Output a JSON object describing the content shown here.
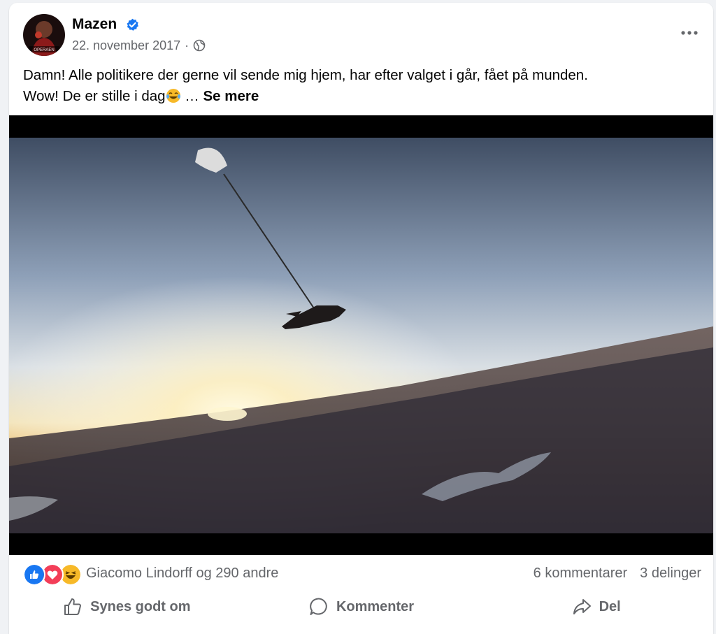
{
  "post": {
    "author": "Mazen",
    "avatar_caption": "OPERAEN",
    "date": "22. november 2017",
    "separator": "·",
    "text_line1": "Damn! Alle politikere der gerne vil sende mig hjem, har efter valget i går, fået på munden.",
    "text_line2": "Wow! De er stille i dag",
    "ellipsis": " … ",
    "see_more": "Se mere"
  },
  "reactions": {
    "summary": "Giacomo Lindorff og 290 andre",
    "icons": [
      "like-icon",
      "love-icon",
      "haha-icon"
    ],
    "comments": "6 kommentarer",
    "shares": "3 delinger"
  },
  "actions": {
    "like": "Synes godt om",
    "comment": "Kommenter",
    "share": "Del"
  },
  "colors": {
    "like_blue": "#1877f2",
    "love_red": "#f33e58",
    "haha_yellow": "#f7b928",
    "verified_blue": "#1877f2",
    "secondary_text": "#65676b"
  }
}
